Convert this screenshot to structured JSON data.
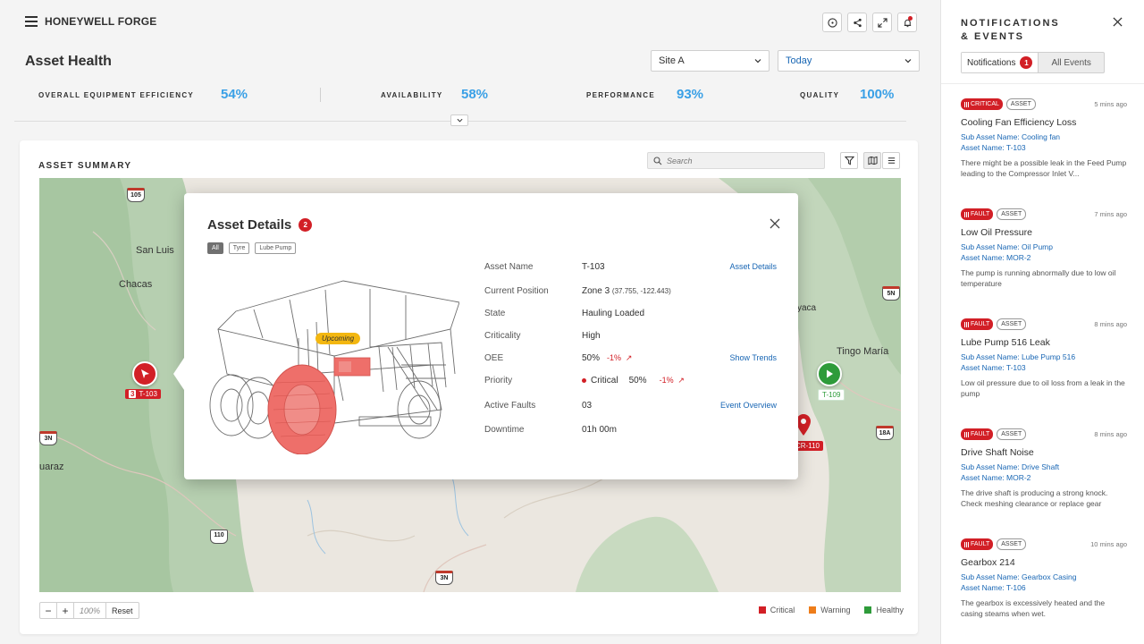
{
  "header": {
    "brand": "HONEYWELL FORGE",
    "page_title": "Asset Health",
    "site_select": "Site A",
    "date_select": "Today"
  },
  "kpis": [
    {
      "label": "OVERALL EQUIPMENT EFFICIENCY",
      "value": "54%"
    },
    {
      "label": "AVAILABILITY",
      "value": "58%"
    },
    {
      "label": "PERFORMANCE",
      "value": "93%"
    },
    {
      "label": "QUALITY",
      "value": "100%"
    }
  ],
  "summary": {
    "title": "ASSET SUMMARY",
    "search_placeholder": "Search",
    "zoom_level": "100%",
    "reset_label": "Reset",
    "zoom_in": "+",
    "zoom_out": "−",
    "legend": [
      {
        "label": "Critical",
        "color": "#d21f26"
      },
      {
        "label": "Warning",
        "color": "#ee7d1a"
      },
      {
        "label": "Healthy",
        "color": "#2e9b3a"
      }
    ]
  },
  "map": {
    "places": [
      "San Luis",
      "Chacas",
      "Tingo María",
      "uaraz",
      "yaca"
    ],
    "shields": [
      "105",
      "5N",
      "3N",
      "18A",
      "110",
      "3N"
    ],
    "markers": {
      "t103_count": "3",
      "t103_label": "T-103",
      "t109_label": "T-109",
      "cr110_label": "CR-110"
    }
  },
  "modal": {
    "title": "Asset Details",
    "count": "2",
    "chips": [
      "All",
      "Tyre",
      "Lube Pump"
    ],
    "upcoming": "Upcoming",
    "rows": {
      "asset_name": {
        "label": "Asset Name",
        "value": "T-103",
        "link": "Asset Details"
      },
      "position": {
        "label": "Current Position",
        "value": "Zone 3",
        "coords": "(37.755, -122.443)"
      },
      "state": {
        "label": "State",
        "value": "Hauling Loaded"
      },
      "criticality": {
        "label": "Criticality",
        "value": "High"
      },
      "oee": {
        "label": "OEE",
        "value": "50%",
        "trend": "-1%",
        "link": "Show Trends"
      },
      "priority": {
        "label": "Priority",
        "value": "Critical",
        "pct": "50%",
        "trend": "-1%"
      },
      "faults": {
        "label": "Active Faults",
        "value": "03",
        "link": "Event Overview"
      },
      "downtime": {
        "label": "Downtime",
        "value": "01h 00m"
      }
    }
  },
  "panel": {
    "title_line1": "NOTIFICATIONS",
    "title_line2": "& EVENTS",
    "tab_notifications": "Notifications",
    "tab_count": "1",
    "tab_all": "All Events",
    "items": [
      {
        "severity": "CRITICAL",
        "type": "ASSET",
        "time": "5 mins ago",
        "title": "Cooling Fan Efficiency Loss",
        "sub_asset": "Sub Asset Name: Cooling fan",
        "asset": "Asset Name:  T-103",
        "desc": "There might be a possible leak in the Feed Pump leading to the Compressor Inlet V..."
      },
      {
        "severity": "FAULT",
        "type": "ASSET",
        "time": "7 mins ago",
        "title": "Low Oil Pressure",
        "sub_asset": "Sub Asset Name: Oil Pump",
        "asset": "Asset Name:  MOR-2",
        "desc": "The pump is running abnormally due to low oil temperature"
      },
      {
        "severity": "FAULT",
        "type": "ASSET",
        "time": "8 mins ago",
        "title": "Lube Pump 516 Leak",
        "sub_asset": "Sub Asset Name: Lube Pump 516",
        "asset": "Asset Name:  T-103",
        "desc": "Low oil pressure due to oil loss from a leak in the pump"
      },
      {
        "severity": "FAULT",
        "type": "ASSET",
        "time": "8 mins ago",
        "title": "Drive Shaft Noise",
        "sub_asset": "Sub Asset Name: Drive Shaft",
        "asset": "Asset Name:  MOR-2",
        "desc": "The drive shaft is producing a strong knock. Check meshing clearance or replace gear"
      },
      {
        "severity": "FAULT",
        "type": "ASSET",
        "time": "10 mins ago",
        "title": "Gearbox 214",
        "sub_asset": "Sub Asset Name: Gearbox Casing",
        "asset": "Asset Name:  T-106",
        "desc": "The gearbox is excessively heated and the casing steams when wet."
      }
    ]
  }
}
